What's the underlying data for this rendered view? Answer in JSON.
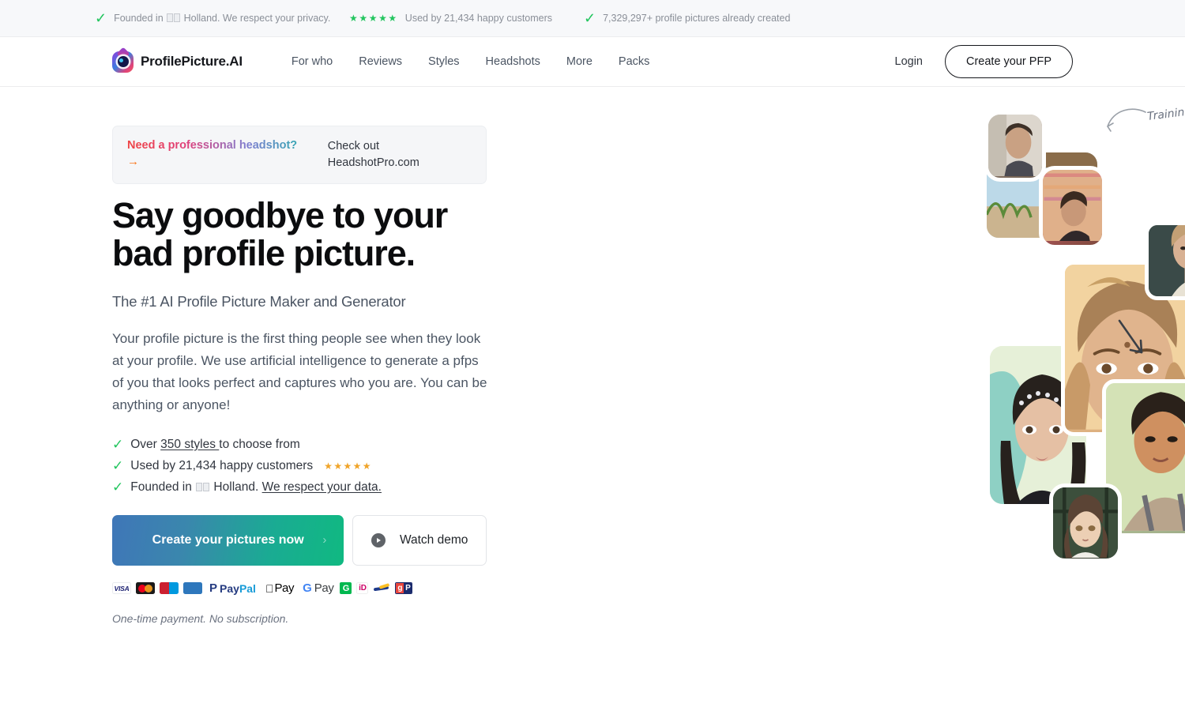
{
  "topbar": {
    "items": [
      {
        "icon": "check-icon",
        "text_before": "Founded in ",
        "text_after": " Holland. We respect your privacy.",
        "flag": "NL"
      },
      {
        "icon": "five-stars-icon",
        "text": "Used by 21,434 happy customers"
      },
      {
        "icon": "check-icon",
        "text": "7,329,297+ profile pictures already created"
      }
    ]
  },
  "header": {
    "brand_name": "ProfilePicture.AI",
    "nav": [
      {
        "label": "For who"
      },
      {
        "label": "Reviews"
      },
      {
        "label": "Styles"
      },
      {
        "label": "Headshots"
      },
      {
        "label": "More"
      },
      {
        "label": "Packs"
      }
    ],
    "login_label": "Login",
    "cta_label": "Create your PFP"
  },
  "promo": {
    "strong": "Need a professional headshot?",
    "arrow": "→",
    "text": "Check out HeadshotPro.com"
  },
  "hero": {
    "headline": "Say goodbye to your bad profile picture.",
    "subhead": "The #1 AI Profile Picture Maker and Generator",
    "body": "Your profile picture is the first thing people see when they look at your profile. We use artificial intelligence to generate a pfps of you that looks perfect and captures who you are. You can be anything or anyone!",
    "bullets": [
      {
        "prefix": "Over ",
        "link": "350 styles ",
        "suffix": "to choose from",
        "stars": ""
      },
      {
        "prefix": "Used by 21,434 happy customers",
        "link": "",
        "suffix": "",
        "stars": "★★★★★"
      },
      {
        "prefix": "Founded in ",
        "link": "",
        "suffix": " Holland. ",
        "link2": "We respect your data.",
        "flag": "NL"
      }
    ],
    "cta_primary": "Create your pictures now",
    "cta_primary_chevron": "›",
    "cta_secondary": "Watch demo",
    "fineprint": "One-time payment. No subscription."
  },
  "payments": [
    {
      "name": "visa",
      "label": "VISA"
    },
    {
      "name": "mastercard",
      "label": ""
    },
    {
      "name": "maestro",
      "label": "Maestro"
    },
    {
      "name": "amex",
      "label": "AMEX"
    },
    {
      "name": "paypal",
      "label": "PayPal"
    },
    {
      "name": "apple-pay",
      "label": "Pay"
    },
    {
      "name": "google-pay",
      "label": "Pay"
    },
    {
      "name": "giropay",
      "label": "G"
    },
    {
      "name": "ideal",
      "label": "iD"
    },
    {
      "name": "sofort",
      "label": ""
    },
    {
      "name": "gp",
      "label": "gP"
    }
  ],
  "collage": {
    "annotation": "Training set",
    "photos": [
      {
        "id": "p-train1",
        "kind": "training"
      },
      {
        "id": "p-train2",
        "kind": "training"
      },
      {
        "id": "p-train3",
        "kind": "training"
      },
      {
        "id": "p-g1",
        "kind": "generated"
      },
      {
        "id": "p-g2",
        "kind": "generated"
      },
      {
        "id": "p-g3",
        "kind": "generated"
      },
      {
        "id": "p-g4",
        "kind": "generated"
      },
      {
        "id": "p-g5",
        "kind": "generated"
      },
      {
        "id": "p-g6",
        "kind": "generated"
      },
      {
        "id": "p-g7",
        "kind": "generated"
      },
      {
        "id": "p-g8",
        "kind": "generated"
      },
      {
        "id": "p-g9",
        "kind": "generated"
      }
    ]
  },
  "colors": {
    "accent_green": "#22c55e",
    "star_gold": "#f0a429",
    "cta_gradient_from": "#3f76b8",
    "cta_gradient_to": "#10b981",
    "promo_bg": "#f5f6f8",
    "topbar_bg": "#f7f8fa",
    "text_dark": "#0b0c0e",
    "text_muted": "#4b5563"
  }
}
